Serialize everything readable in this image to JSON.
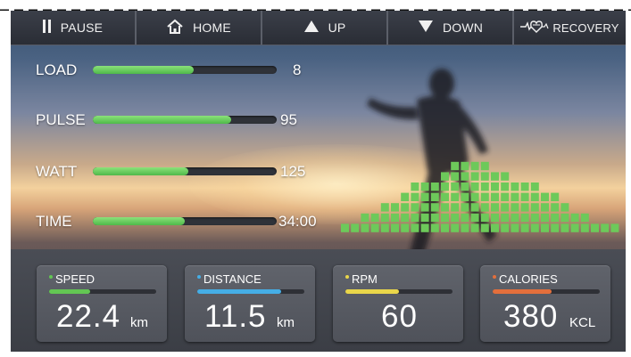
{
  "toolbar": {
    "pause": {
      "label": "PAUSE",
      "icon": "pause-icon"
    },
    "home": {
      "label": "HOME",
      "icon": "home-icon"
    },
    "up": {
      "label": "UP",
      "icon": "triangle-up-icon"
    },
    "down": {
      "label": "DOWN",
      "icon": "triangle-down-icon"
    },
    "recovery": {
      "label": "RECOVERY",
      "icon": "heart-pulse-icon"
    }
  },
  "metrics": [
    {
      "label": "LOAD",
      "value": "8",
      "level": 0.55
    },
    {
      "label": "PULSE",
      "value": "95",
      "level": 0.75
    },
    {
      "label": "WATT",
      "value": "125",
      "level": 0.52
    },
    {
      "label": "TIME",
      "value": "34:00",
      "level": 0.5
    }
  ],
  "histogram": {
    "color": "#6dc95a",
    "column_heights": [
      1,
      1,
      2,
      2,
      3,
      3,
      4,
      5,
      5,
      5,
      6,
      7,
      7,
      7,
      7,
      6,
      6,
      5,
      5,
      5,
      4,
      4,
      3,
      2,
      2,
      1,
      1,
      1
    ]
  },
  "cards": [
    {
      "title": "SPEED",
      "value": "22.4",
      "unit": "km",
      "color": "#63c653",
      "level": 0.38
    },
    {
      "title": "DISTANCE",
      "value": "11.5",
      "unit": "km",
      "color": "#45aee6",
      "level": 0.78
    },
    {
      "title": "RPM",
      "value": "60",
      "unit": "",
      "color": "#e9d64a",
      "level": 0.5
    },
    {
      "title": "CALORIES",
      "value": "380",
      "unit": "KCL",
      "color": "#e36f3c",
      "level": 0.55
    }
  ]
}
